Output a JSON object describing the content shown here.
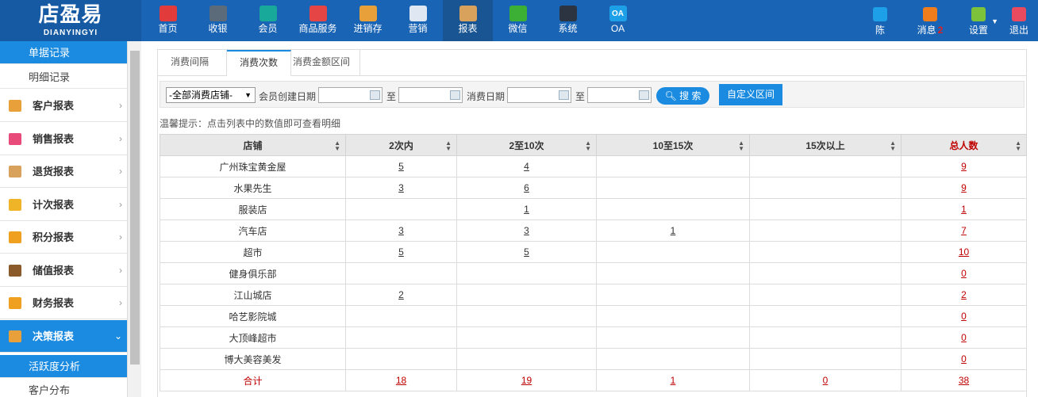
{
  "logo": {
    "main": "店盈易",
    "sub": "DIANYINGYI"
  },
  "nav": [
    {
      "label": "首页",
      "icon": "home-icon",
      "color": "#e23b3b"
    },
    {
      "label": "收银",
      "icon": "cash-register-icon",
      "color": "#5b6b7a"
    },
    {
      "label": "会员",
      "icon": "member-icon",
      "color": "#19a99b"
    },
    {
      "label": "商品服务",
      "icon": "product-icon",
      "color": "#e54545"
    },
    {
      "label": "进销存",
      "icon": "inventory-icon",
      "color": "#e8a13a"
    },
    {
      "label": "营销",
      "icon": "marketing-icon",
      "color": "#dfe8f2"
    },
    {
      "label": "报表",
      "icon": "report-icon",
      "color": "#d9a25c"
    },
    {
      "label": "微信",
      "icon": "wechat-icon",
      "color": "#3cb034"
    },
    {
      "label": "系统",
      "icon": "system-icon",
      "color": "#2b3440"
    },
    {
      "label": "OA",
      "icon": "oa-icon",
      "color": "#1ea0e8"
    }
  ],
  "right_nav": {
    "user": {
      "label": "陈",
      "icon": "user-icon",
      "color": "#1ea0e8"
    },
    "messages": {
      "label": "消息",
      "count": "2",
      "icon": "bell-icon",
      "color": "#f07d1c"
    },
    "settings": {
      "label": "设置",
      "icon": "gear-icon",
      "color": "#7cc23a"
    },
    "logout": {
      "label": "退出",
      "icon": "logout-icon",
      "color": "#e84a5f"
    }
  },
  "sidebar": {
    "top_items": [
      "单据记录",
      "明细记录"
    ],
    "groups": [
      {
        "label": "客户报表",
        "icon": "customer-report-icon",
        "color": "#e8a13a"
      },
      {
        "label": "销售报表",
        "icon": "sales-report-icon",
        "color": "#e84a7a"
      },
      {
        "label": "退货报表",
        "icon": "return-report-icon",
        "color": "#d9a25c"
      },
      {
        "label": "计次报表",
        "icon": "count-report-icon",
        "color": "#f0b429"
      },
      {
        "label": "积分报表",
        "icon": "points-report-icon",
        "color": "#f0a020"
      },
      {
        "label": "储值报表",
        "icon": "stored-value-report-icon",
        "color": "#8a5a2b"
      },
      {
        "label": "财务报表",
        "icon": "finance-report-icon",
        "color": "#f0a020"
      },
      {
        "label": "决策报表",
        "icon": "decision-report-icon",
        "color": "#e8a13a"
      }
    ],
    "sub_items": [
      "活跃度分析",
      "客户分布"
    ]
  },
  "tabs": [
    "消费间隔",
    "消费次数",
    "消费金额区间"
  ],
  "filter": {
    "store_select": "-全部消费店铺-",
    "create_date_label": "会员创建日期",
    "to1": "至",
    "consume_date_label": "消费日期",
    "to2": "至",
    "search_label": "搜 索",
    "custom_label": "自定义区间"
  },
  "tip": "温馨提示：点击列表中的数值即可查看明细",
  "table": {
    "headers": [
      "店铺",
      "2次内",
      "2至10次",
      "10至15次",
      "15次以上",
      "总人数"
    ],
    "rows": [
      [
        "广州珠宝黄金屋",
        "5",
        "4",
        "",
        "",
        "9"
      ],
      [
        "水果先生",
        "3",
        "6",
        "",
        "",
        "9"
      ],
      [
        "服装店",
        "",
        "1",
        "",
        "",
        "1"
      ],
      [
        "汽车店",
        "3",
        "3",
        "1",
        "",
        "7"
      ],
      [
        "超市",
        "5",
        "5",
        "",
        "",
        "10"
      ],
      [
        "健身俱乐部",
        "",
        "",
        "",
        "",
        "0"
      ],
      [
        "江山城店",
        "2",
        "",
        "",
        "",
        "2"
      ],
      [
        "哈艺影院城",
        "",
        "",
        "",
        "",
        "0"
      ],
      [
        "大顶峰超市",
        "",
        "",
        "",
        "",
        "0"
      ],
      [
        "博大美容美发",
        "",
        "",
        "",
        "",
        "0"
      ]
    ],
    "total": [
      "合计",
      "18",
      "19",
      "1",
      "0",
      "38"
    ]
  }
}
